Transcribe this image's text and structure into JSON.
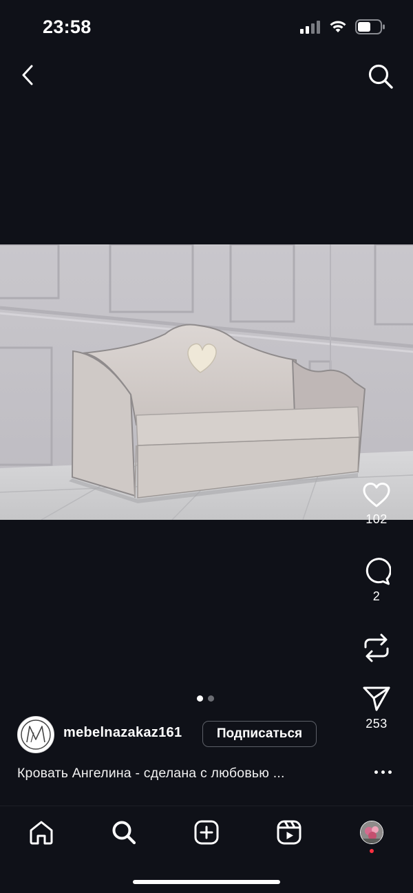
{
  "status_bar": {
    "time": "23:58"
  },
  "post": {
    "likes_count": "102",
    "comments_count": "2",
    "shares_count": "253",
    "pager": {
      "total": 2,
      "current": 1
    }
  },
  "author": {
    "username": "mebelnazakaz161",
    "follow_label": "Подписаться"
  },
  "caption": "Кровать Ангелина - сделана с любовью ...",
  "colors": {
    "background": "#0f1118",
    "text": "#ffffff",
    "notification_dot": "#ff3040"
  },
  "icons": {
    "back": "chevron-left-icon",
    "search": "search-icon",
    "like": "heart-icon",
    "comment": "comment-bubble-icon",
    "repost": "repost-icon",
    "share": "paper-plane-icon",
    "more": "more-dots-icon",
    "nav": [
      "home-icon",
      "search-icon",
      "create-plus-icon",
      "reels-icon",
      "profile-avatar"
    ]
  }
}
